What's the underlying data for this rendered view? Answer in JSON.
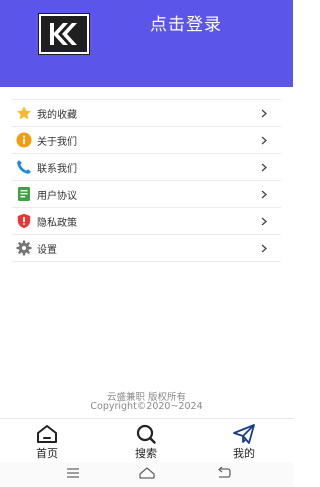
{
  "header": {
    "login_label": "点击登录",
    "background_color": "#5b55ea",
    "logo_icon": "k-logo-icon"
  },
  "menu": {
    "items": [
      {
        "label": "我的收藏",
        "icon": "star-icon",
        "color": "#f5b82e"
      },
      {
        "label": "关于我们",
        "icon": "info-icon",
        "color": "#f39c12"
      },
      {
        "label": "联系我们",
        "icon": "phone-icon",
        "color": "#1e88e5"
      },
      {
        "label": "用户协议",
        "icon": "document-icon",
        "color": "#43a047"
      },
      {
        "label": "隐私政策",
        "icon": "shield-icon",
        "color": "#e53935"
      },
      {
        "label": "设置",
        "icon": "gear-icon",
        "color": "#757575"
      }
    ]
  },
  "footer": {
    "line1": "云盛兼职  版权所有",
    "line2": "Copyright©2020~2024"
  },
  "tabbar": {
    "tabs": [
      {
        "label": "首页",
        "icon": "home-icon"
      },
      {
        "label": "搜索",
        "icon": "search-icon"
      },
      {
        "label": "我的",
        "icon": "paper-plane-icon"
      }
    ]
  },
  "system_nav": {
    "buttons": [
      "menu-icon",
      "home-icon",
      "back-icon"
    ]
  }
}
